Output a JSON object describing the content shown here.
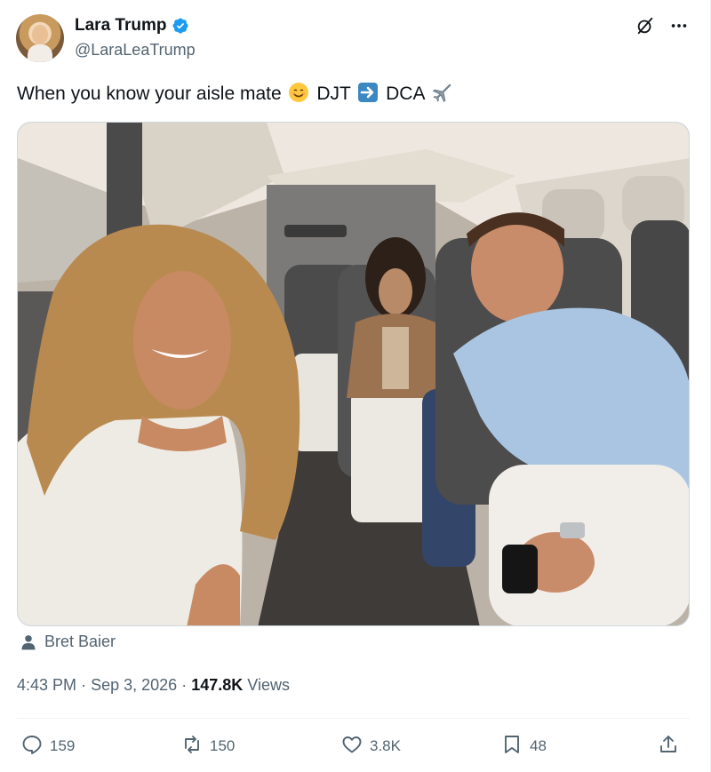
{
  "author": {
    "display_name": "Lara Trump",
    "handle": "@LaraLeaTrump",
    "verified": true
  },
  "tweet": {
    "text_before": "When you know your aisle mate",
    "text_mid": "DJT",
    "text_end": "DCA"
  },
  "icons": {
    "smile_emoji": "smiling-face-emoji",
    "arrow_emoji": "right-arrow-emoji",
    "plane_emoji": "airplane-emoji"
  },
  "tagged": {
    "name": "Bret Baier"
  },
  "meta": {
    "time": "4:43 PM",
    "date": "Sep 3, 2026",
    "views_count": "147.8K",
    "views_label": "Views",
    "separator": "·"
  },
  "actions": {
    "replies": "159",
    "reposts": "150",
    "likes": "3.8K",
    "bookmarks": "48"
  },
  "colors": {
    "verified_blue": "#1d9bf0",
    "secondary_text": "#536471",
    "primary_text": "#0f1419"
  }
}
